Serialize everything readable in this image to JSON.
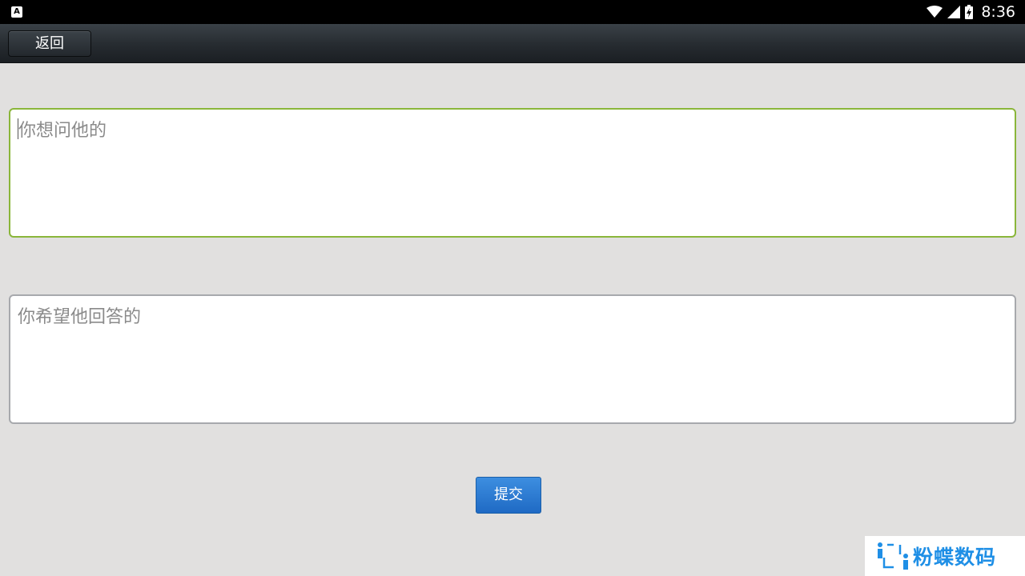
{
  "status_bar": {
    "notification_icon": "a-box-icon",
    "wifi_icon": "wifi-icon",
    "signal_icon": "cell-signal-icon",
    "battery_icon": "battery-charging-icon",
    "time": "8:36"
  },
  "toolbar": {
    "back_label": "返回"
  },
  "form": {
    "question_placeholder": "你想问他的",
    "answer_placeholder": "你希望他回答的",
    "submit_label": "提交"
  },
  "watermark": {
    "text": "粉蝶数码",
    "color": "#1f8fe6"
  },
  "colors": {
    "focused_border": "#8ab63a",
    "submit_button": "#2a78d2"
  }
}
